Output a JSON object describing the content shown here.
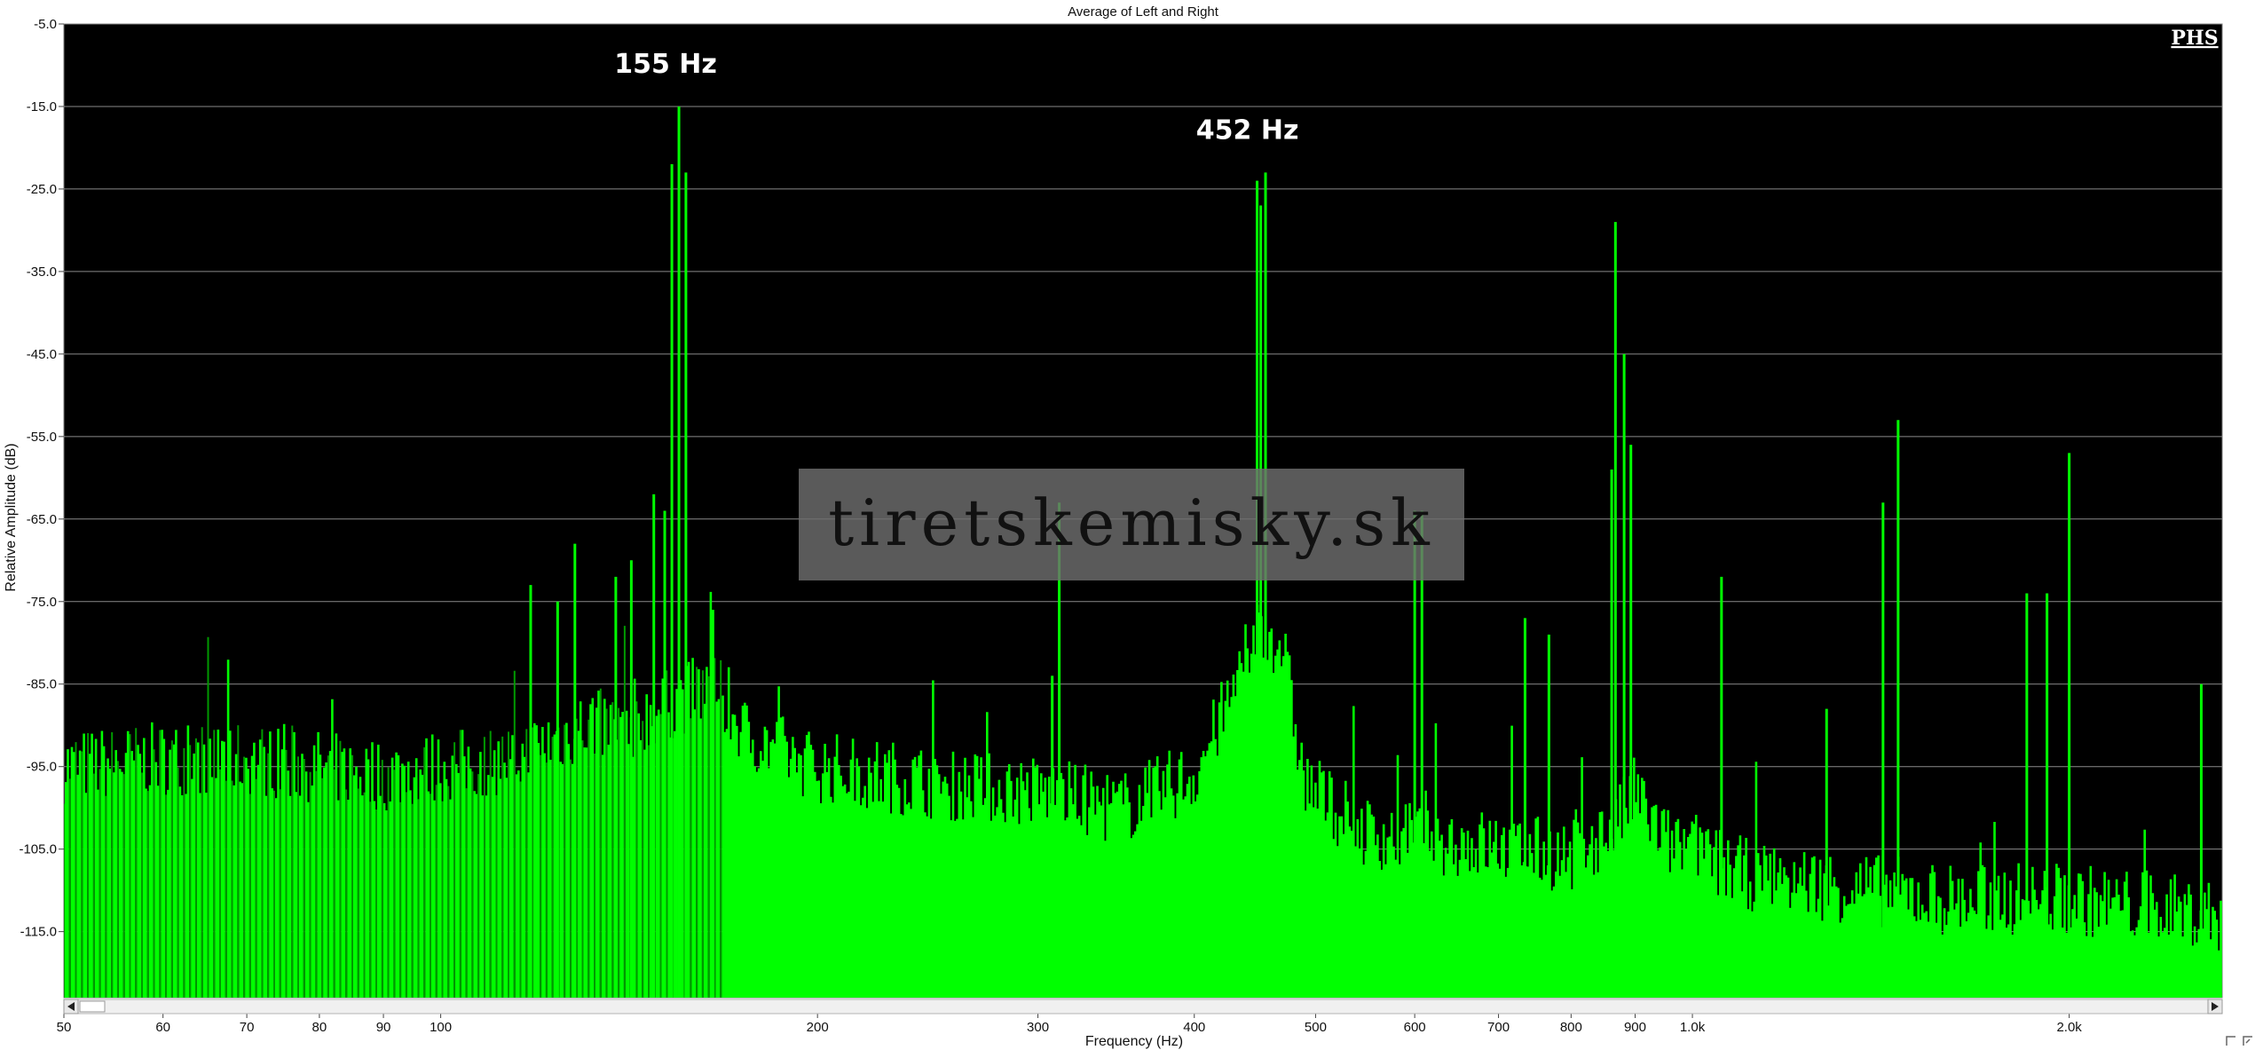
{
  "chart_data": {
    "type": "area",
    "title": "Average of Left and Right",
    "xlabel": "Frequency (Hz)",
    "ylabel": "Relative Amplitude (dB)",
    "x_scale": "log",
    "xlim": [
      50,
      2650
    ],
    "ylim": [
      -123,
      -5
    ],
    "y_ticks": [
      "-5.0",
      "-15.0",
      "-25.0",
      "-35.0",
      "-45.0",
      "-55.0",
      "-65.0",
      "-75.0",
      "-85.0",
      "-95.0",
      "-105.0",
      "-115.0"
    ],
    "x_ticks": [
      {
        "value": 50,
        "label": "50"
      },
      {
        "value": 60,
        "label": "60"
      },
      {
        "value": 70,
        "label": "70"
      },
      {
        "value": 80,
        "label": "80"
      },
      {
        "value": 90,
        "label": "90"
      },
      {
        "value": 100,
        "label": "100"
      },
      {
        "value": 200,
        "label": "200"
      },
      {
        "value": 300,
        "label": "300"
      },
      {
        "value": 400,
        "label": "400"
      },
      {
        "value": 500,
        "label": "500"
      },
      {
        "value": 600,
        "label": "600"
      },
      {
        "value": 700,
        "label": "700"
      },
      {
        "value": 800,
        "label": "800"
      },
      {
        "value": 900,
        "label": "900"
      },
      {
        "value": 1000,
        "label": "1.0k"
      },
      {
        "value": 2000,
        "label": "2.0k"
      }
    ],
    "grid": true,
    "series": [
      {
        "color": "#00ff00",
        "floor_points": [
          [
            50,
            -95
          ],
          [
            60,
            -94
          ],
          [
            70,
            -94
          ],
          [
            80,
            -95
          ],
          [
            90,
            -96
          ],
          [
            100,
            -95
          ],
          [
            115,
            -94
          ],
          [
            130,
            -90
          ],
          [
            140,
            -90
          ],
          [
            150,
            -88
          ],
          [
            165,
            -85
          ],
          [
            175,
            -91
          ],
          [
            200,
            -95
          ],
          [
            250,
            -97
          ],
          [
            300,
            -98
          ],
          [
            350,
            -100
          ],
          [
            400,
            -96
          ],
          [
            430,
            -86
          ],
          [
            450,
            -78
          ],
          [
            470,
            -80
          ],
          [
            490,
            -97
          ],
          [
            550,
            -103
          ],
          [
            650,
            -104
          ],
          [
            800,
            -106
          ],
          [
            870,
            -102
          ],
          [
            900,
            -98
          ],
          [
            950,
            -104
          ],
          [
            1100,
            -108
          ],
          [
            1400,
            -110
          ],
          [
            1600,
            -111
          ],
          [
            2000,
            -111
          ],
          [
            2650,
            -113
          ]
        ],
        "peaks": [
          {
            "x": 118,
            "y": -73
          },
          {
            "x": 124,
            "y": -75
          },
          {
            "x": 128,
            "y": -68
          },
          {
            "x": 138,
            "y": -72
          },
          {
            "x": 142,
            "y": -70
          },
          {
            "x": 148,
            "y": -62
          },
          {
            "x": 151,
            "y": -64
          },
          {
            "x": 153,
            "y": -22
          },
          {
            "x": 155,
            "y": -15
          },
          {
            "x": 157,
            "y": -23
          },
          {
            "x": 165,
            "y": -76
          },
          {
            "x": 312,
            "y": -63
          },
          {
            "x": 308,
            "y": -84
          },
          {
            "x": 449,
            "y": -24
          },
          {
            "x": 452,
            "y": -27
          },
          {
            "x": 456,
            "y": -23
          },
          {
            "x": 600,
            "y": -64
          },
          {
            "x": 608,
            "y": -64
          },
          {
            "x": 735,
            "y": -77
          },
          {
            "x": 768,
            "y": -79
          },
          {
            "x": 862,
            "y": -59
          },
          {
            "x": 868,
            "y": -29
          },
          {
            "x": 882,
            "y": -45
          },
          {
            "x": 893,
            "y": -56
          },
          {
            "x": 1055,
            "y": -72
          },
          {
            "x": 1280,
            "y": -88
          },
          {
            "x": 1420,
            "y": -63
          },
          {
            "x": 1460,
            "y": -53
          },
          {
            "x": 1850,
            "y": -74
          },
          {
            "x": 1920,
            "y": -74
          },
          {
            "x": 2000,
            "y": -57
          },
          {
            "x": 2550,
            "y": -85
          }
        ]
      }
    ],
    "annotations": [
      {
        "text": "155 Hz",
        "x": 155,
        "y": -15
      },
      {
        "text": "452 Hz",
        "x": 452,
        "y": -23
      }
    ]
  },
  "logo_text": "PHS",
  "watermark_text": "tiretskemisky.sk",
  "colors": {
    "plot_bg": "#000000",
    "trace": "#00ff00",
    "trace_dark": "#009900",
    "grid": "#8a8a8a",
    "watermark_box": "#6e6e6e"
  }
}
